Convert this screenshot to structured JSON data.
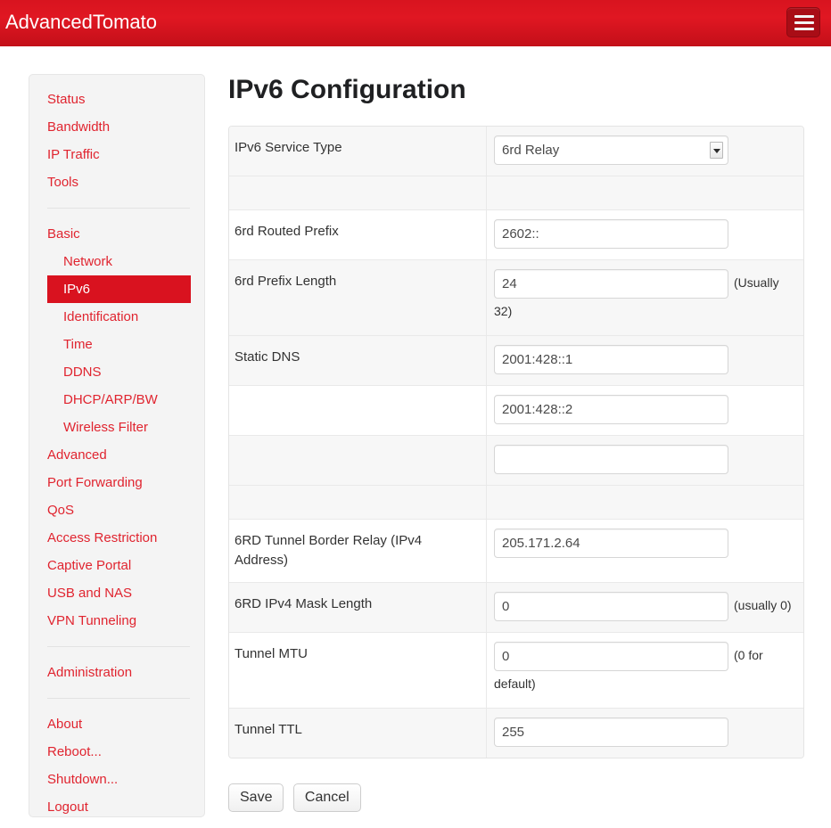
{
  "header": {
    "brand": "AdvancedTomato",
    "menu_icon": "hamburger-menu-icon"
  },
  "sidebar": {
    "groups": [
      {
        "items": [
          {
            "label": "Status",
            "sub": false,
            "active": false
          },
          {
            "label": "Bandwidth",
            "sub": false,
            "active": false
          },
          {
            "label": "IP Traffic",
            "sub": false,
            "active": false
          },
          {
            "label": "Tools",
            "sub": false,
            "active": false
          }
        ]
      },
      {
        "items": [
          {
            "label": "Basic",
            "sub": false,
            "active": false
          },
          {
            "label": "Network",
            "sub": true,
            "active": false
          },
          {
            "label": "IPv6",
            "sub": true,
            "active": true
          },
          {
            "label": "Identification",
            "sub": true,
            "active": false
          },
          {
            "label": "Time",
            "sub": true,
            "active": false
          },
          {
            "label": "DDNS",
            "sub": true,
            "active": false
          },
          {
            "label": "DHCP/ARP/BW",
            "sub": true,
            "active": false
          },
          {
            "label": "Wireless Filter",
            "sub": true,
            "active": false
          },
          {
            "label": "Advanced",
            "sub": false,
            "active": false
          },
          {
            "label": "Port Forwarding",
            "sub": false,
            "active": false
          },
          {
            "label": "QoS",
            "sub": false,
            "active": false
          },
          {
            "label": "Access Restriction",
            "sub": false,
            "active": false
          },
          {
            "label": "Captive Portal",
            "sub": false,
            "active": false
          },
          {
            "label": "USB and NAS",
            "sub": false,
            "active": false
          },
          {
            "label": "VPN Tunneling",
            "sub": false,
            "active": false
          }
        ]
      },
      {
        "items": [
          {
            "label": "Administration",
            "sub": false,
            "active": false
          }
        ]
      },
      {
        "items": [
          {
            "label": "About",
            "sub": false,
            "active": false
          },
          {
            "label": "Reboot...",
            "sub": false,
            "active": false
          },
          {
            "label": "Shutdown...",
            "sub": false,
            "active": false
          },
          {
            "label": "Logout",
            "sub": false,
            "active": false
          }
        ]
      }
    ]
  },
  "main": {
    "title": "IPv6 Configuration",
    "fields": {
      "service_type": {
        "label": "IPv6 Service Type",
        "value": "6rd Relay",
        "options": [
          "6rd Relay"
        ]
      },
      "routed_prefix": {
        "label": "6rd Routed Prefix",
        "value": "2602::"
      },
      "prefix_length": {
        "label": "6rd Prefix Length",
        "value": "24",
        "hint": "(Usually 32)"
      },
      "static_dns_1": {
        "label": "Static DNS",
        "value": "2001:428::1"
      },
      "static_dns_2": {
        "label": "",
        "value": "2001:428::2"
      },
      "static_dns_3": {
        "label": "",
        "value": ""
      },
      "border_relay": {
        "label": "6RD Tunnel Border Relay (IPv4 Address)",
        "value": "205.171.2.64"
      },
      "mask_length": {
        "label": "6RD IPv4 Mask Length",
        "value": "0",
        "hint": "(usually 0)"
      },
      "tunnel_mtu": {
        "label": "Tunnel MTU",
        "value": "0",
        "hint": "(0 for default)"
      },
      "tunnel_ttl": {
        "label": "Tunnel TTL",
        "value": "255"
      }
    },
    "buttons": {
      "save": "Save",
      "cancel": "Cancel"
    }
  },
  "colors": {
    "brand_red": "#d9121f",
    "nav_link_red": "#e0242f",
    "header_gradient_top": "#d8141f",
    "header_gradient_bottom": "#c30f19",
    "row_shade": "#f7f7f7",
    "sidebar_bg": "#f4f4f4"
  }
}
